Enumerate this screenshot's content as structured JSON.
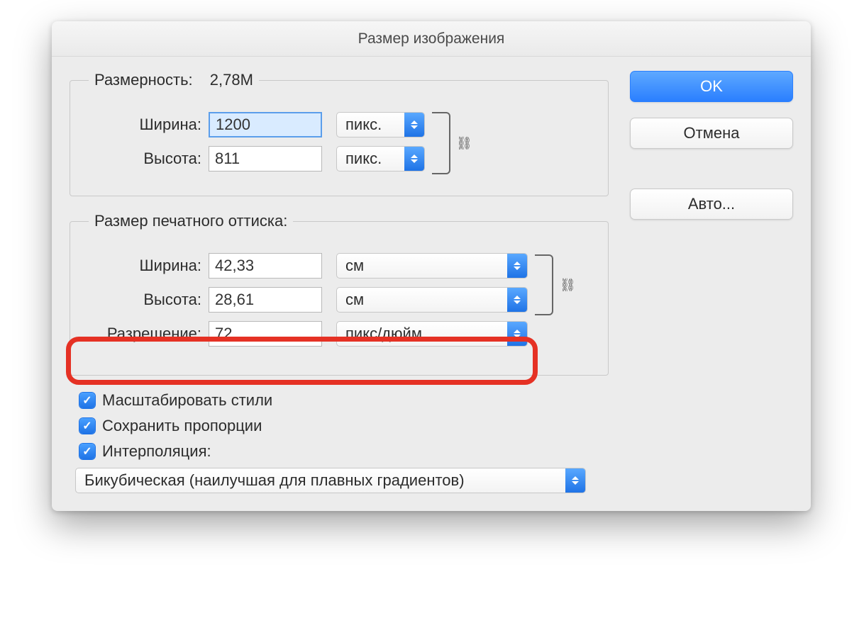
{
  "dialog": {
    "title": "Размер изображения"
  },
  "pixel_group": {
    "legend_label": "Размерность:",
    "legend_value": "2,78M",
    "width_label": "Ширина:",
    "width_value": "1200",
    "width_unit": "пикс.",
    "height_label": "Высота:",
    "height_value": "811",
    "height_unit": "пикс."
  },
  "print_group": {
    "legend": "Размер печатного оттиска:",
    "width_label": "Ширина:",
    "width_value": "42,33",
    "width_unit": "см",
    "height_label": "Высота:",
    "height_value": "28,61",
    "height_unit": "см",
    "res_label": "Разрешение:",
    "res_value": "72",
    "res_unit": "пикс/дюйм"
  },
  "checks": {
    "scale_styles": "Масштабировать стили",
    "constrain": "Сохранить пропорции",
    "resample": "Интерполяция:"
  },
  "resample_method": "Бикубическая (наилучшая для плавных градиентов)",
  "buttons": {
    "ok": "OK",
    "cancel": "Отмена",
    "auto": "Авто..."
  }
}
